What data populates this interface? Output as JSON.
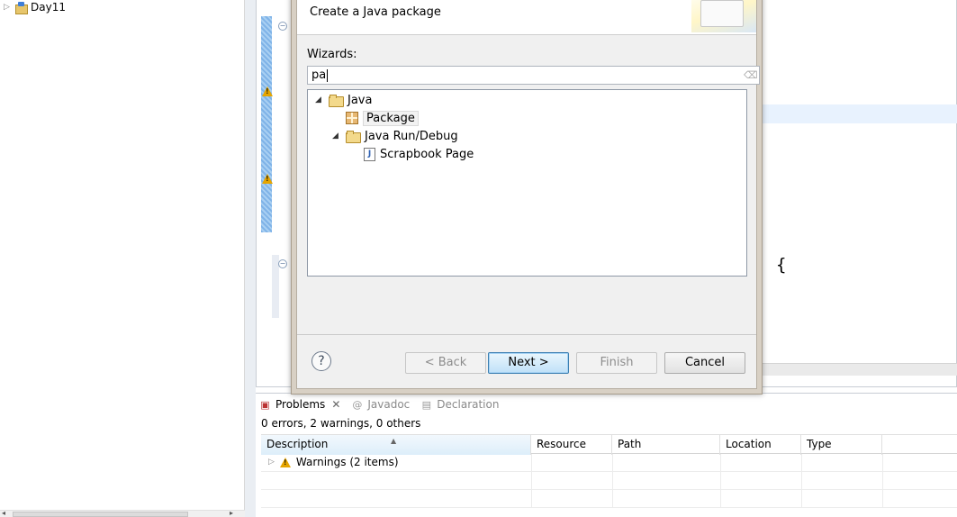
{
  "explorer": {
    "project_name": "Day11"
  },
  "editor": {
    "code_fragment": "{"
  },
  "dialog": {
    "message": "Create a Java package",
    "wizards_label": "Wizards:",
    "filter_value": "pa",
    "tree": [
      {
        "label": "Java",
        "type": "folder",
        "expanded": true
      },
      {
        "label": "Package",
        "type": "package",
        "selected": true
      },
      {
        "label": "Java Run/Debug",
        "type": "folder",
        "expanded": true
      },
      {
        "label": "Scrapbook Page",
        "type": "scrapbook"
      }
    ],
    "buttons": {
      "help": "?",
      "back": "< Back",
      "next": "Next >",
      "finish": "Finish",
      "cancel": "Cancel"
    }
  },
  "problems": {
    "tabs": [
      {
        "label": "Problems",
        "active": true
      },
      {
        "label": "Javadoc",
        "active": false
      },
      {
        "label": "Declaration",
        "active": false
      }
    ],
    "summary": "0 errors, 2 warnings, 0 others",
    "columns": [
      "Description",
      "Resource",
      "Path",
      "Location",
      "Type"
    ],
    "rows": [
      {
        "description": "Warnings (2 items)"
      }
    ]
  }
}
